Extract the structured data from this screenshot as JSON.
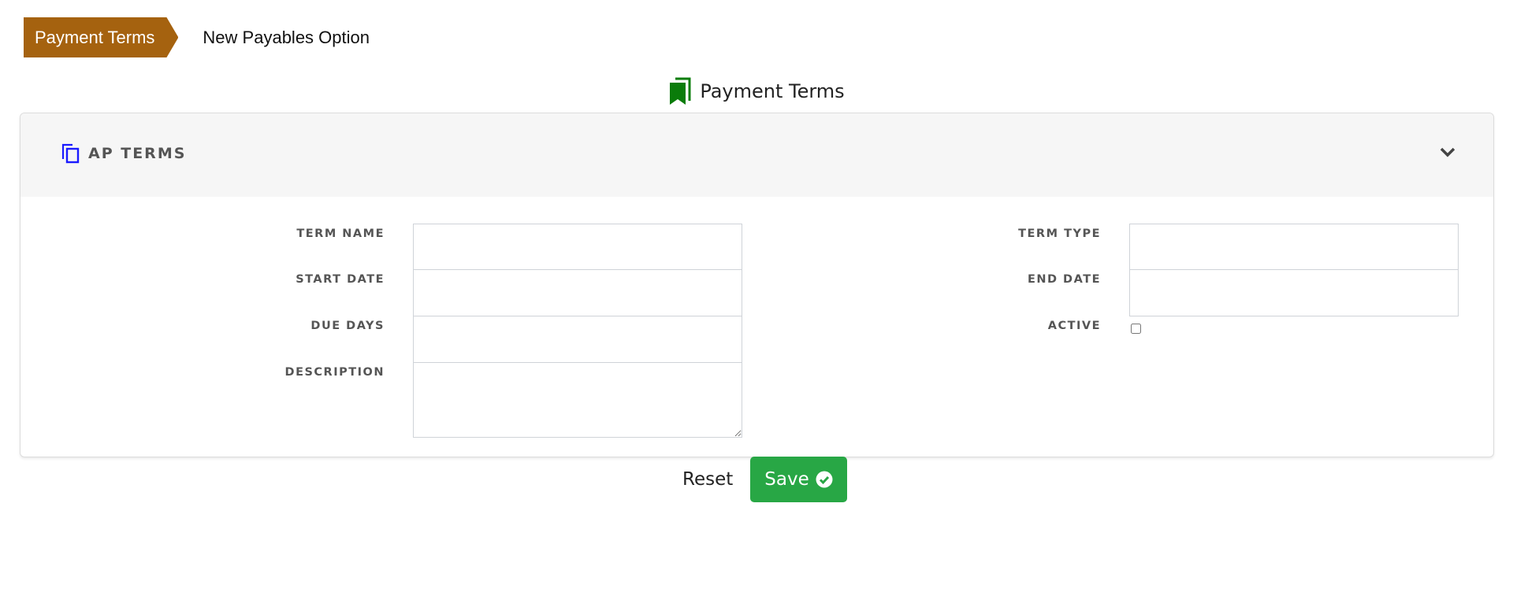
{
  "breadcrumb": {
    "items": [
      {
        "label": "Payment Terms",
        "active": true
      },
      {
        "label": "New Payables Option",
        "active": false
      }
    ],
    "active_color": "#A5620F"
  },
  "page": {
    "title": "Payment Terms",
    "title_icon": "bookmarks-icon",
    "title_icon_color": "#0a7c0a"
  },
  "section": {
    "title": "AP TERMS",
    "icon": "copy-icon",
    "icon_color": "#1a1aff",
    "toggle_icon": "chevron-down-icon"
  },
  "form": {
    "left_fields": [
      {
        "label": "TERM NAME",
        "value": "",
        "type": "text"
      },
      {
        "label": "START DATE",
        "value": "",
        "type": "text"
      },
      {
        "label": "DUE DAYS",
        "value": "",
        "type": "text"
      },
      {
        "label": "DESCRIPTION",
        "value": "",
        "type": "textarea"
      }
    ],
    "right_fields": [
      {
        "label": "TERM TYPE",
        "value": "",
        "type": "text"
      },
      {
        "label": "END DATE",
        "value": "",
        "type": "text"
      },
      {
        "label": "ACTIVE",
        "checked": false,
        "type": "checkbox"
      }
    ]
  },
  "actions": {
    "reset_label": "Reset",
    "save_label": "Save",
    "save_icon": "check-circle-icon",
    "save_color": "#28a745"
  }
}
